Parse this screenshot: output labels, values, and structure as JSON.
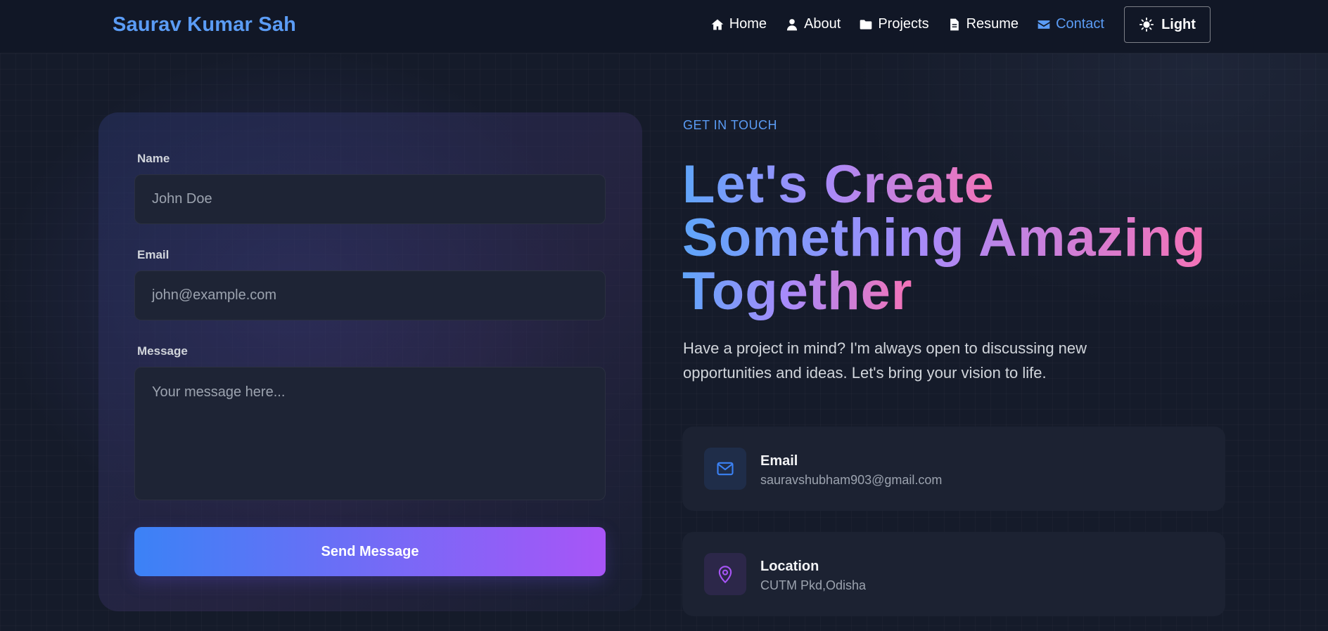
{
  "nav": {
    "brand": "Saurav Kumar Sah",
    "links": [
      {
        "label": "Home",
        "icon": "home-icon"
      },
      {
        "label": "About",
        "icon": "user-icon"
      },
      {
        "label": "Projects",
        "icon": "folder-icon"
      },
      {
        "label": "Resume",
        "icon": "document-icon"
      },
      {
        "label": "Contact",
        "icon": "envelope-icon",
        "active": true
      }
    ],
    "theme_toggle": {
      "label": "Light",
      "icon": "sun-icon"
    }
  },
  "form": {
    "name_label": "Name",
    "name_placeholder": "John Doe",
    "email_label": "Email",
    "email_placeholder": "john@example.com",
    "message_label": "Message",
    "message_placeholder": "Your message here...",
    "submit_label": "Send Message"
  },
  "hero": {
    "eyebrow": "GET IN TOUCH",
    "headline_1": "Let's Create",
    "headline_2": "Something Amazing",
    "headline_3": "Together",
    "intro": "Have a project in mind? I'm always open to discussing new opportunities and ideas. Let's bring your vision to life."
  },
  "contact_info": [
    {
      "title": "Email",
      "value": "sauravshubham903@gmail.com",
      "icon": "mail-icon",
      "color": "#3b82f6"
    },
    {
      "title": "Location",
      "value": "CUTM Pkd,Odisha",
      "icon": "map-pin-icon",
      "color": "#a855f7"
    }
  ],
  "colors": {
    "accent_blue": "#5b9cf5",
    "gradient_start": "#3b82f6",
    "gradient_end": "#a855f7",
    "headline_pink": "#f472b6"
  }
}
